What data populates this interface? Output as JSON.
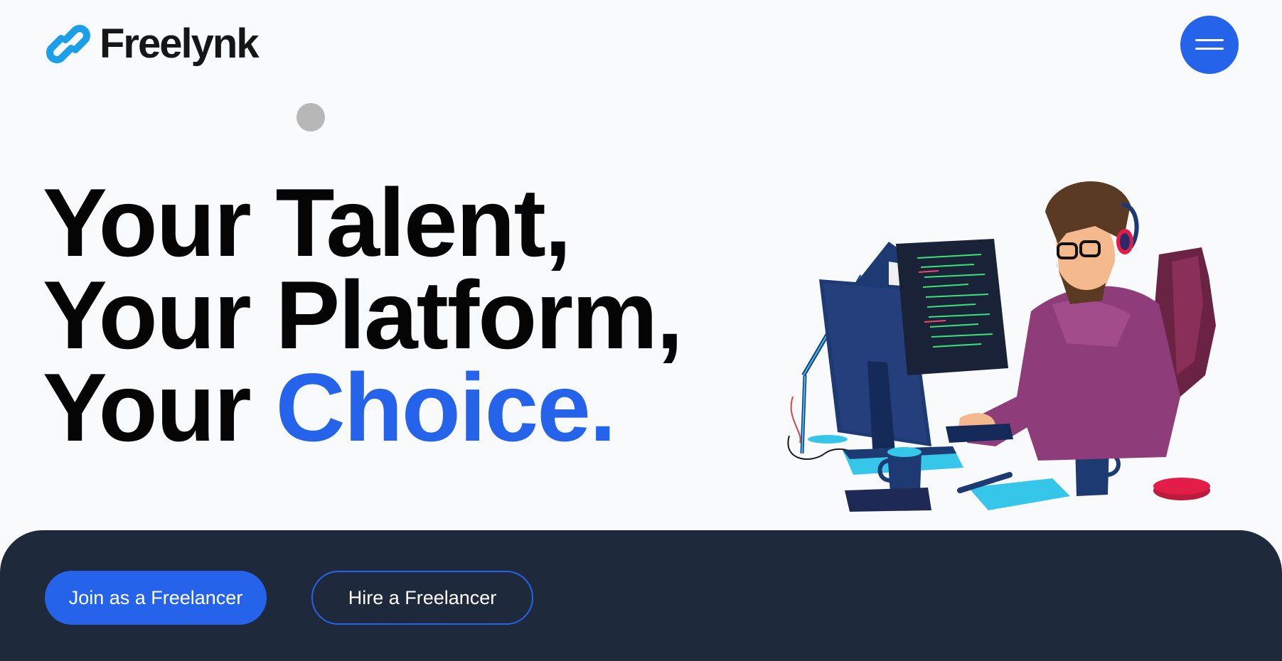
{
  "brand": {
    "name": "Freelynk",
    "icon": "link-chain-icon",
    "accent_color": "#2563eb"
  },
  "nav": {
    "menu_icon": "hamburger-menu-icon"
  },
  "hero": {
    "line1": "Your Talent,",
    "line2": "Your Platform,",
    "line3_prefix": "Your ",
    "line3_accent": "Choice."
  },
  "illustration": {
    "subject": "pixel-art developer at computer",
    "screen_code": "code"
  },
  "cta": {
    "primary_label": "Join as a Freelancer",
    "secondary_label": "Hire a Freelancer"
  },
  "colors": {
    "background": "#f8fafc",
    "bottom_bar": "#1e293b",
    "text": "#050505"
  }
}
